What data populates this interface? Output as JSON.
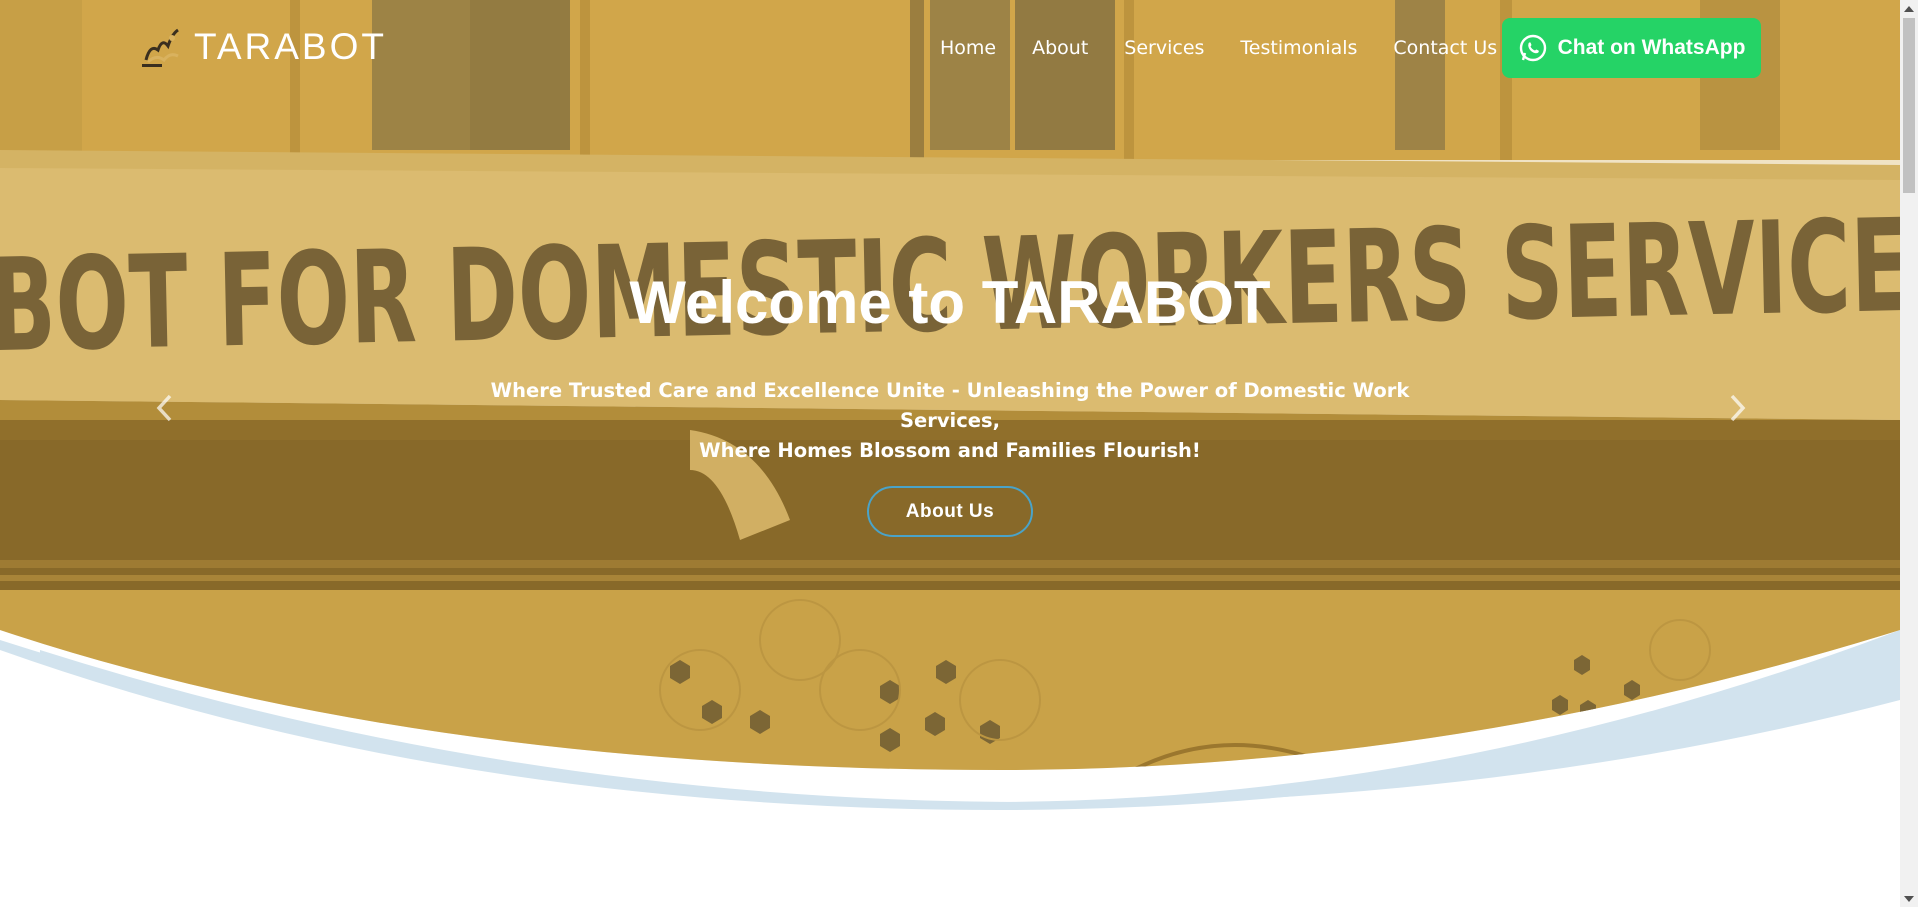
{
  "brand": {
    "name": "TARABOT",
    "logo_icon": "tarabot-logo-icon"
  },
  "nav": {
    "items": [
      {
        "label": "Home"
      },
      {
        "label": "About"
      },
      {
        "label": "Services"
      },
      {
        "label": "Testimonials"
      },
      {
        "label": "Contact Us"
      }
    ],
    "whatsapp_label": "Chat on WhatsApp",
    "whatsapp_icon": "whatsapp-icon"
  },
  "hero": {
    "title": "Welcome to TARABOT",
    "subtitle_line1": "Where Trusted Care and Excellence Unite - Unleashing the Power of Domestic Work Services,",
    "subtitle_line2": "Where Homes Blossom and Families Flourish!",
    "cta_label": "About Us",
    "background_sign_text": "BOT FOR DOMESTIC WORKERS SERVICE",
    "prev_icon": "chevron-left-icon",
    "next_icon": "chevron-right-icon"
  },
  "colors": {
    "overlay": "#c89a2e",
    "whatsapp_green": "#25d366",
    "cta_border": "#4aa3c8",
    "wave_blue": "#d2e3ee"
  }
}
